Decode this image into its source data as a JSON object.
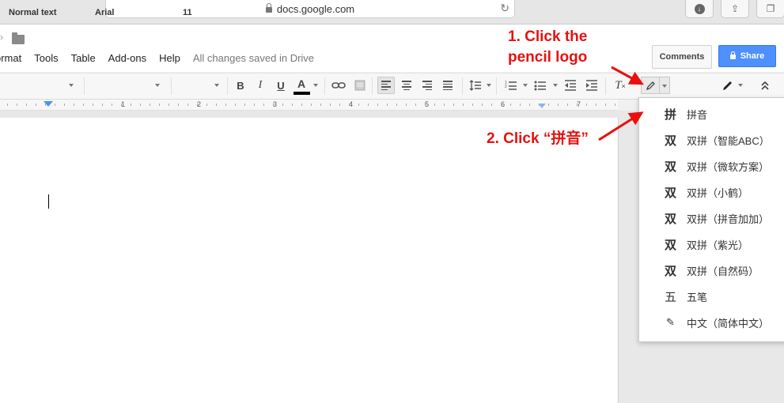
{
  "browser": {
    "url": "docs.google.com"
  },
  "menu": {
    "items": [
      "ormat",
      "Tools",
      "Table",
      "Add-ons",
      "Help"
    ],
    "save_status": "All changes saved in Drive"
  },
  "header": {
    "comments_label": "Comments",
    "share_label": "Share"
  },
  "toolbar": {
    "style": "Normal text",
    "font": "Arial",
    "size": "11",
    "bold": "B",
    "italic": "I",
    "underline": "U",
    "text_color": "A"
  },
  "ruler": {
    "numbers": [
      "1",
      "2",
      "3",
      "4",
      "5",
      "6",
      "7"
    ]
  },
  "input_tools_menu": {
    "items": [
      {
        "glyph": "拼",
        "label": "拼音",
        "icon": "pinyin-icon"
      },
      {
        "glyph": "双",
        "label": "双拼（智能ABC）",
        "icon": "shuangpin-icon"
      },
      {
        "glyph": "双",
        "label": "双拼（微软方案）",
        "icon": "shuangpin-icon"
      },
      {
        "glyph": "双",
        "label": "双拼（小鹤）",
        "icon": "shuangpin-icon"
      },
      {
        "glyph": "双",
        "label": "双拼（拼音加加）",
        "icon": "shuangpin-icon"
      },
      {
        "glyph": "双",
        "label": "双拼（紫光）",
        "icon": "shuangpin-icon"
      },
      {
        "glyph": "双",
        "label": "双拼（自然码）",
        "icon": "shuangpin-icon"
      },
      {
        "glyph": "五",
        "label": "五笔",
        "icon": "wubi-icon"
      },
      {
        "glyph": "✎",
        "label": "中文（简体中文）",
        "icon": "handwriting-pencil-icon"
      }
    ]
  },
  "annotations": {
    "step1_line1": "1. Click the",
    "step1_line2": "pencil logo",
    "step2": "2. Click “拼音”"
  },
  "colors": {
    "annotation_red": "#e8110f",
    "share_blue": "#4d90fe"
  }
}
